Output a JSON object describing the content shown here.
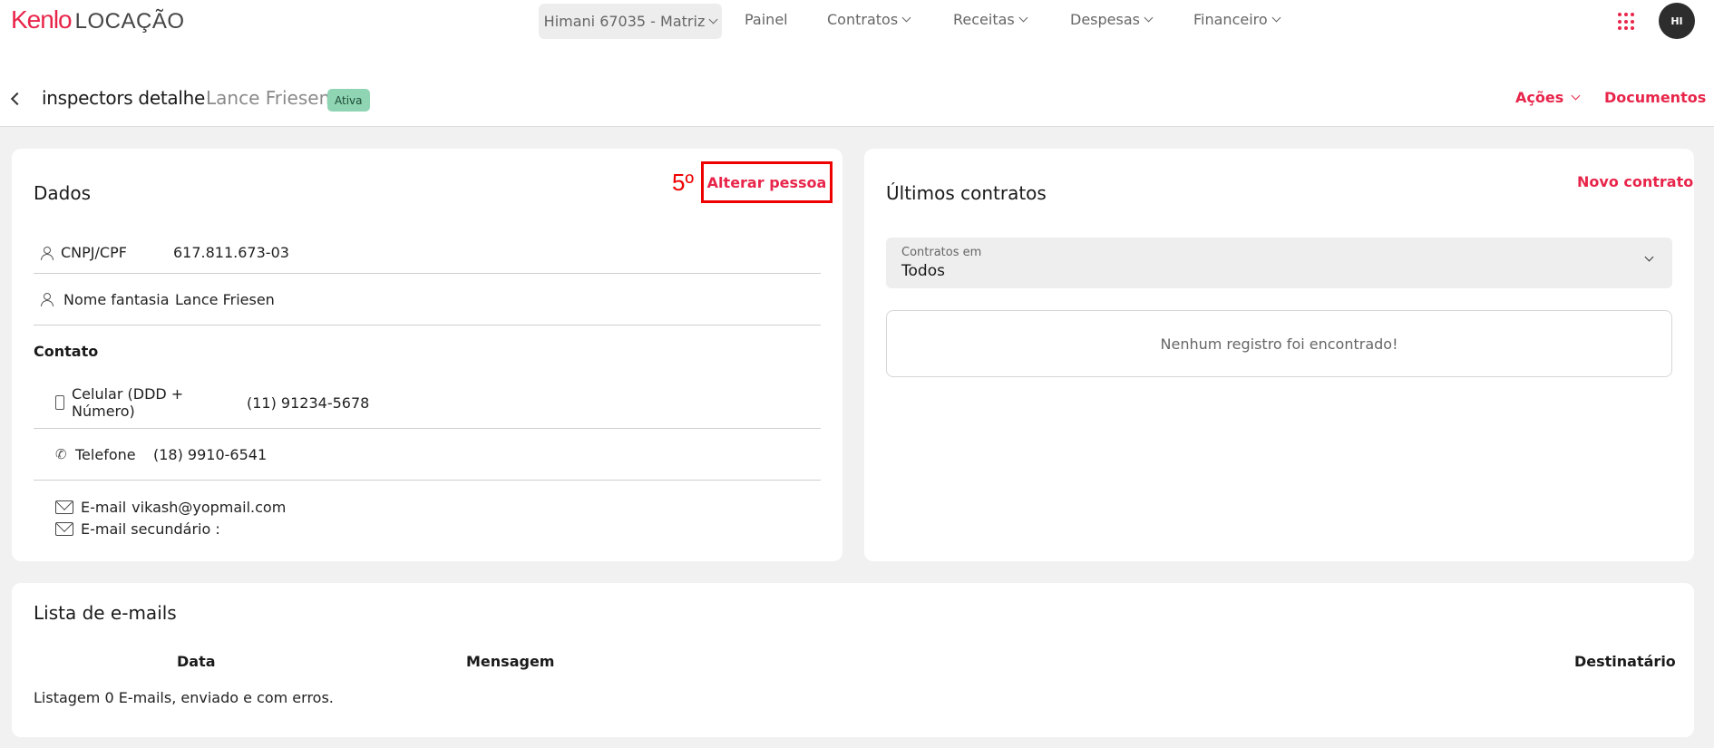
{
  "topbar": {
    "brand": "Kenlo",
    "product": "LOCAÇÃO",
    "branch": "Himani 67035 - Matriz",
    "nav": [
      "Painel",
      "Contratos",
      "Receitas",
      "Despesas",
      "Financeiro"
    ],
    "avatar": "HI"
  },
  "header": {
    "title": "inspectors detalhe",
    "person": "Lance Friesen",
    "status": "Ativa",
    "actions": "Ações",
    "documents": "Documentos"
  },
  "dados": {
    "title": "Dados",
    "annotation": "5º",
    "change_button": "Alterar pessoa",
    "cnpj_label": "CNPJ/CPF",
    "cnpj_value": "617.811.673-03",
    "fantasy_label": "Nome fantasia",
    "fantasy_value": "Lance Friesen",
    "contact_heading": "Contato",
    "cell_label": "Celular (DDD + Número)",
    "cell_value": "(11) 91234-5678",
    "phone_label": "Telefone",
    "phone_value": "(18) 9910-6541",
    "email_label": "E-mail",
    "email_value": "vikash@yopmail.com",
    "email2_label": "E-mail secundário :",
    "email2_value": ""
  },
  "contracts": {
    "title": "Últimos contratos",
    "new_contract": "Novo contrato",
    "filter_label": "Contratos em",
    "filter_value": "Todos",
    "empty_message": "Nenhum registro foi encontrado!"
  },
  "emails": {
    "title": "Lista de e-mails",
    "columns": [
      "Data",
      "Mensagem",
      "Destinatário"
    ],
    "footer": "Listagem 0 E-mails, enviado e com erros."
  },
  "colors": {
    "accent": "#e8254a",
    "status_badge": "#8fd4b3",
    "annotation": "#ee0000"
  }
}
